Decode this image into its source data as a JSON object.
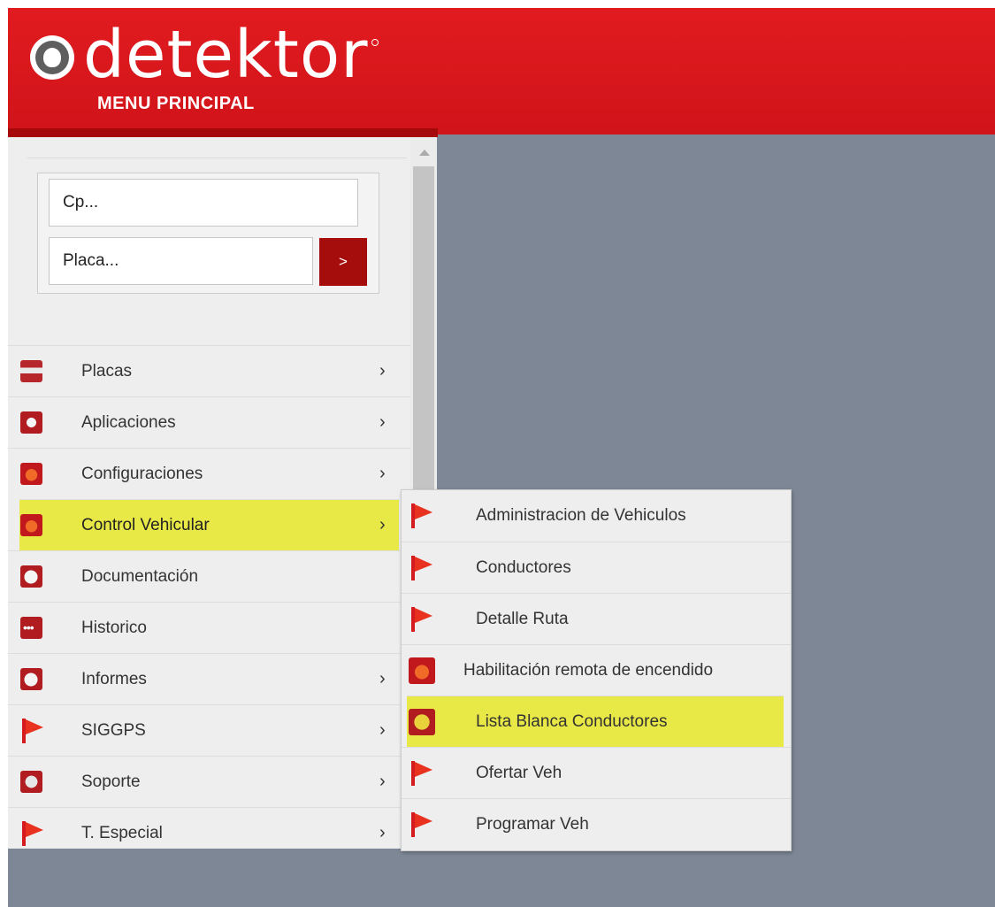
{
  "brand": {
    "logo_icon": "detektor-logo-icon",
    "name": "detektor",
    "subtitle": "MENU PRINCIPAL"
  },
  "search": {
    "cp_placeholder": "Cp...",
    "placa_placeholder": "Placa...",
    "go_label": ">"
  },
  "sidebar": {
    "items": [
      {
        "label": "Placas",
        "icon": "license-plate-icon",
        "chevron": "›"
      },
      {
        "label": "Aplicaciones",
        "icon": "applications-icon",
        "chevron": "›"
      },
      {
        "label": "Configuraciones",
        "icon": "gear-icon",
        "chevron": "›"
      },
      {
        "label": "Control Vehicular",
        "icon": "gear-icon",
        "chevron": "›"
      },
      {
        "label": "Documentación",
        "icon": "document-icon",
        "chevron": ""
      },
      {
        "label": "Historico",
        "icon": "history-icon",
        "chevron": ""
      },
      {
        "label": "Informes",
        "icon": "document-icon",
        "chevron": "›"
      },
      {
        "label": "SIGGPS",
        "icon": "flag-icon",
        "chevron": "›"
      },
      {
        "label": "Soporte",
        "icon": "support-icon",
        "chevron": "›"
      },
      {
        "label": "T. Especial",
        "icon": "flag-icon",
        "chevron": "›"
      }
    ]
  },
  "submenu": {
    "items": [
      {
        "label": "Administracion de Vehiculos",
        "icon": "flag-icon"
      },
      {
        "label": "Conductores",
        "icon": "flag-icon"
      },
      {
        "label": "Detalle Ruta",
        "icon": "flag-icon"
      },
      {
        "label": "Habilitación remota de encendido",
        "icon": "gear-icon"
      },
      {
        "label": "Lista Blanca Conductores",
        "icon": "puzzle-icon"
      },
      {
        "label": "Ofertar Veh",
        "icon": "flag-icon"
      },
      {
        "label": "Programar Veh",
        "icon": "flag-icon"
      }
    ]
  },
  "colors": {
    "header_red": "#d7171c",
    "highlight_yellow": "#e8e846",
    "background_gray": "#7e8796"
  }
}
